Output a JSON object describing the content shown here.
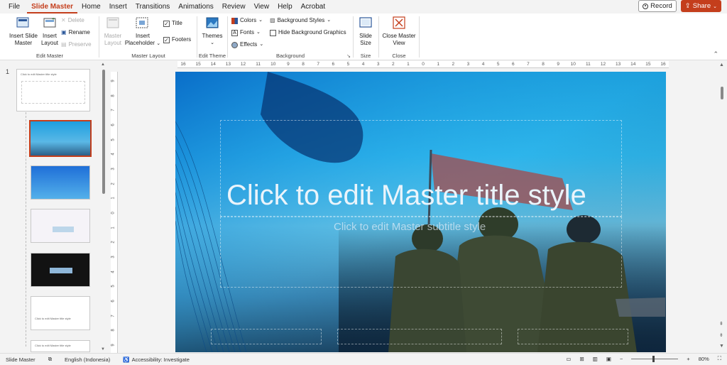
{
  "menu": {
    "items": [
      "File",
      "Slide Master",
      "Home",
      "Insert",
      "Transitions",
      "Animations",
      "Review",
      "View",
      "Help",
      "Acrobat"
    ],
    "active": "Slide Master",
    "record_label": "Record",
    "share_label": "Share"
  },
  "ribbon": {
    "edit_master": {
      "insert_slide_master": "Insert Slide Master",
      "insert_layout": "Insert Layout",
      "delete": "Delete",
      "rename": "Rename",
      "preserve": "Preserve",
      "label": "Edit Master"
    },
    "master_layout": {
      "master_layout": "Master Layout",
      "insert_placeholder": "Insert Placeholder",
      "title": "Title",
      "footers": "Footers",
      "label": "Master Layout"
    },
    "edit_theme": {
      "themes": "Themes",
      "label": "Edit Theme"
    },
    "background": {
      "colors": "Colors",
      "fonts": "Fonts",
      "effects": "Effects",
      "background_styles": "Background Styles",
      "hide_background_graphics": "Hide Background Graphics",
      "label": "Background"
    },
    "size": {
      "slide_size": "Slide Size",
      "label": "Size"
    },
    "close": {
      "close_master_view": "Close Master View",
      "label": "Close"
    }
  },
  "left_pane": {
    "slide_number": "1",
    "master_thumb_title": "Click to edit Master title style",
    "thumb_5_title": "Click to edit Master title style",
    "thumb_6_title": "Click to edit Master title style"
  },
  "ruler": {
    "h_ticks": [
      "16",
      "15",
      "14",
      "13",
      "12",
      "11",
      "10",
      "9",
      "8",
      "7",
      "6",
      "5",
      "4",
      "3",
      "2",
      "1",
      "0",
      "1",
      "2",
      "3",
      "4",
      "5",
      "6",
      "7",
      "8",
      "9",
      "10",
      "11",
      "12",
      "13",
      "14",
      "15",
      "16"
    ],
    "v_ticks": [
      "9",
      "8",
      "7",
      "6",
      "5",
      "4",
      "3",
      "2",
      "1",
      "0",
      "1",
      "2",
      "3",
      "4",
      "5",
      "6",
      "7",
      "8",
      "9"
    ]
  },
  "slide": {
    "title": "Click to edit Master title style",
    "subtitle": "Click to edit Master subtitle style"
  },
  "status": {
    "view": "Slide Master",
    "language": "English (Indonesia)",
    "accessibility": "Accessibility: Investigate",
    "zoom": "80%"
  },
  "colors": {
    "accent": "#c43e1c",
    "slide_blue": "#1a9bd8"
  }
}
